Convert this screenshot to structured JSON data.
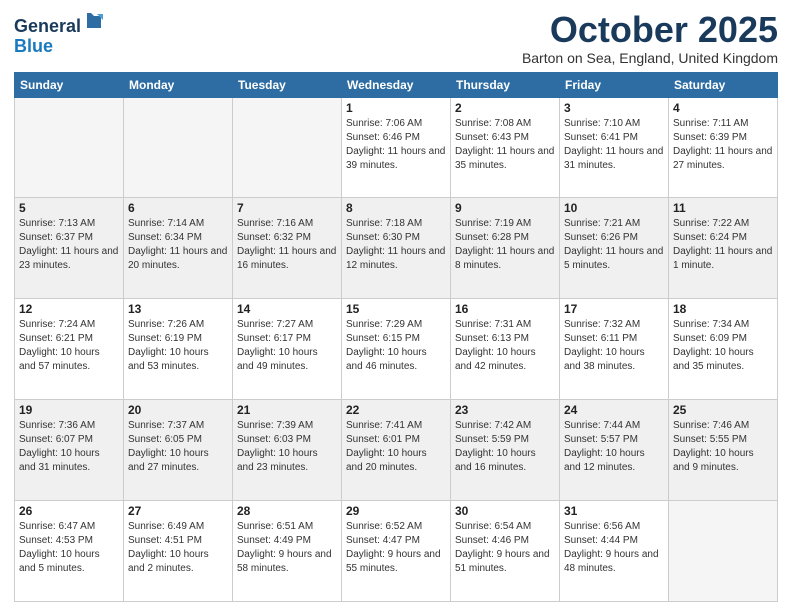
{
  "header": {
    "logo_line1": "General",
    "logo_line2": "Blue",
    "month_title": "October 2025",
    "location": "Barton on Sea, England, United Kingdom"
  },
  "weekdays": [
    "Sunday",
    "Monday",
    "Tuesday",
    "Wednesday",
    "Thursday",
    "Friday",
    "Saturday"
  ],
  "weeks": [
    [
      {
        "day": "",
        "sunrise": "",
        "sunset": "",
        "daylight": "",
        "empty": true
      },
      {
        "day": "",
        "sunrise": "",
        "sunset": "",
        "daylight": "",
        "empty": true
      },
      {
        "day": "",
        "sunrise": "",
        "sunset": "",
        "daylight": "",
        "empty": true
      },
      {
        "day": "1",
        "sunrise": "Sunrise: 7:06 AM",
        "sunset": "Sunset: 6:46 PM",
        "daylight": "Daylight: 11 hours and 39 minutes."
      },
      {
        "day": "2",
        "sunrise": "Sunrise: 7:08 AM",
        "sunset": "Sunset: 6:43 PM",
        "daylight": "Daylight: 11 hours and 35 minutes."
      },
      {
        "day": "3",
        "sunrise": "Sunrise: 7:10 AM",
        "sunset": "Sunset: 6:41 PM",
        "daylight": "Daylight: 11 hours and 31 minutes."
      },
      {
        "day": "4",
        "sunrise": "Sunrise: 7:11 AM",
        "sunset": "Sunset: 6:39 PM",
        "daylight": "Daylight: 11 hours and 27 minutes."
      }
    ],
    [
      {
        "day": "5",
        "sunrise": "Sunrise: 7:13 AM",
        "sunset": "Sunset: 6:37 PM",
        "daylight": "Daylight: 11 hours and 23 minutes."
      },
      {
        "day": "6",
        "sunrise": "Sunrise: 7:14 AM",
        "sunset": "Sunset: 6:34 PM",
        "daylight": "Daylight: 11 hours and 20 minutes."
      },
      {
        "day": "7",
        "sunrise": "Sunrise: 7:16 AM",
        "sunset": "Sunset: 6:32 PM",
        "daylight": "Daylight: 11 hours and 16 minutes."
      },
      {
        "day": "8",
        "sunrise": "Sunrise: 7:18 AM",
        "sunset": "Sunset: 6:30 PM",
        "daylight": "Daylight: 11 hours and 12 minutes."
      },
      {
        "day": "9",
        "sunrise": "Sunrise: 7:19 AM",
        "sunset": "Sunset: 6:28 PM",
        "daylight": "Daylight: 11 hours and 8 minutes."
      },
      {
        "day": "10",
        "sunrise": "Sunrise: 7:21 AM",
        "sunset": "Sunset: 6:26 PM",
        "daylight": "Daylight: 11 hours and 5 minutes."
      },
      {
        "day": "11",
        "sunrise": "Sunrise: 7:22 AM",
        "sunset": "Sunset: 6:24 PM",
        "daylight": "Daylight: 11 hours and 1 minute."
      }
    ],
    [
      {
        "day": "12",
        "sunrise": "Sunrise: 7:24 AM",
        "sunset": "Sunset: 6:21 PM",
        "daylight": "Daylight: 10 hours and 57 minutes."
      },
      {
        "day": "13",
        "sunrise": "Sunrise: 7:26 AM",
        "sunset": "Sunset: 6:19 PM",
        "daylight": "Daylight: 10 hours and 53 minutes."
      },
      {
        "day": "14",
        "sunrise": "Sunrise: 7:27 AM",
        "sunset": "Sunset: 6:17 PM",
        "daylight": "Daylight: 10 hours and 49 minutes."
      },
      {
        "day": "15",
        "sunrise": "Sunrise: 7:29 AM",
        "sunset": "Sunset: 6:15 PM",
        "daylight": "Daylight: 10 hours and 46 minutes."
      },
      {
        "day": "16",
        "sunrise": "Sunrise: 7:31 AM",
        "sunset": "Sunset: 6:13 PM",
        "daylight": "Daylight: 10 hours and 42 minutes."
      },
      {
        "day": "17",
        "sunrise": "Sunrise: 7:32 AM",
        "sunset": "Sunset: 6:11 PM",
        "daylight": "Daylight: 10 hours and 38 minutes."
      },
      {
        "day": "18",
        "sunrise": "Sunrise: 7:34 AM",
        "sunset": "Sunset: 6:09 PM",
        "daylight": "Daylight: 10 hours and 35 minutes."
      }
    ],
    [
      {
        "day": "19",
        "sunrise": "Sunrise: 7:36 AM",
        "sunset": "Sunset: 6:07 PM",
        "daylight": "Daylight: 10 hours and 31 minutes."
      },
      {
        "day": "20",
        "sunrise": "Sunrise: 7:37 AM",
        "sunset": "Sunset: 6:05 PM",
        "daylight": "Daylight: 10 hours and 27 minutes."
      },
      {
        "day": "21",
        "sunrise": "Sunrise: 7:39 AM",
        "sunset": "Sunset: 6:03 PM",
        "daylight": "Daylight: 10 hours and 23 minutes."
      },
      {
        "day": "22",
        "sunrise": "Sunrise: 7:41 AM",
        "sunset": "Sunset: 6:01 PM",
        "daylight": "Daylight: 10 hours and 20 minutes."
      },
      {
        "day": "23",
        "sunrise": "Sunrise: 7:42 AM",
        "sunset": "Sunset: 5:59 PM",
        "daylight": "Daylight: 10 hours and 16 minutes."
      },
      {
        "day": "24",
        "sunrise": "Sunrise: 7:44 AM",
        "sunset": "Sunset: 5:57 PM",
        "daylight": "Daylight: 10 hours and 12 minutes."
      },
      {
        "day": "25",
        "sunrise": "Sunrise: 7:46 AM",
        "sunset": "Sunset: 5:55 PM",
        "daylight": "Daylight: 10 hours and 9 minutes."
      }
    ],
    [
      {
        "day": "26",
        "sunrise": "Sunrise: 6:47 AM",
        "sunset": "Sunset: 4:53 PM",
        "daylight": "Daylight: 10 hours and 5 minutes."
      },
      {
        "day": "27",
        "sunrise": "Sunrise: 6:49 AM",
        "sunset": "Sunset: 4:51 PM",
        "daylight": "Daylight: 10 hours and 2 minutes."
      },
      {
        "day": "28",
        "sunrise": "Sunrise: 6:51 AM",
        "sunset": "Sunset: 4:49 PM",
        "daylight": "Daylight: 9 hours and 58 minutes."
      },
      {
        "day": "29",
        "sunrise": "Sunrise: 6:52 AM",
        "sunset": "Sunset: 4:47 PM",
        "daylight": "Daylight: 9 hours and 55 minutes."
      },
      {
        "day": "30",
        "sunrise": "Sunrise: 6:54 AM",
        "sunset": "Sunset: 4:46 PM",
        "daylight": "Daylight: 9 hours and 51 minutes."
      },
      {
        "day": "31",
        "sunrise": "Sunrise: 6:56 AM",
        "sunset": "Sunset: 4:44 PM",
        "daylight": "Daylight: 9 hours and 48 minutes."
      },
      {
        "day": "",
        "sunrise": "",
        "sunset": "",
        "daylight": "",
        "empty": true
      }
    ]
  ]
}
